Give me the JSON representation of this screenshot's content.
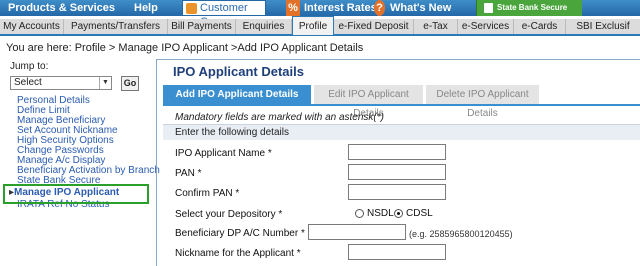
{
  "topbar": {
    "products": "Products & Services",
    "help": "Help",
    "customer_care": "Customer Care",
    "percent": "%",
    "interest_rates": "Interest Rates",
    "question": "?",
    "whats_new": "What's New",
    "otp": "State Bank Secure OTP"
  },
  "tabs": [
    "My Accounts",
    "Payments/Transfers",
    "Bill Payments",
    "Enquiries",
    "Profile",
    "e-Fixed Deposit",
    "e-Tax",
    "e-Services",
    "e-Cards",
    "SBI Exclusif"
  ],
  "breadcrumb": "You are here:  Profile > Manage IPO Applicant >Add IPO Applicant Details",
  "sidebar": {
    "jump_label": "Jump to:",
    "select_value": "Select",
    "go": "Go",
    "links": [
      "Personal Details",
      "Define Limit",
      "Manage Beneficiary",
      "Set Account Nickname",
      "High Security Options",
      "Change Passwords",
      "Manage A/c Display",
      "Beneficiary Activation by Branch",
      "State Bank Secure",
      "Manage IPO Applicant",
      "IRATA Ref No Status"
    ]
  },
  "main": {
    "title": "IPO Applicant Details",
    "tabs": [
      "Add IPO Applicant Details",
      "Edit IPO Applicant Details",
      "Delete IPO Applicant Details"
    ],
    "mandatory": "Mandatory fields are marked with an asterisk(*)",
    "section": "Enter the following details",
    "fields": {
      "name": "IPO Applicant Name *",
      "pan": "PAN *",
      "confirm_pan": "Confirm PAN *",
      "depository": "Select your Depository *",
      "dp_account": "Beneficiary DP A/C Number *",
      "nickname": "Nickname for the Applicant *"
    },
    "depository_options": [
      "NSDL",
      "CDSL"
    ],
    "depository_selected": "CDSL",
    "dp_hint": "(e.g. 2585965800120455)"
  },
  "colors": {
    "topbar": "#2f7cbc",
    "accent": "#3a8fd0",
    "highlight_box": "#2aa02a",
    "link": "#2b5cb0"
  }
}
